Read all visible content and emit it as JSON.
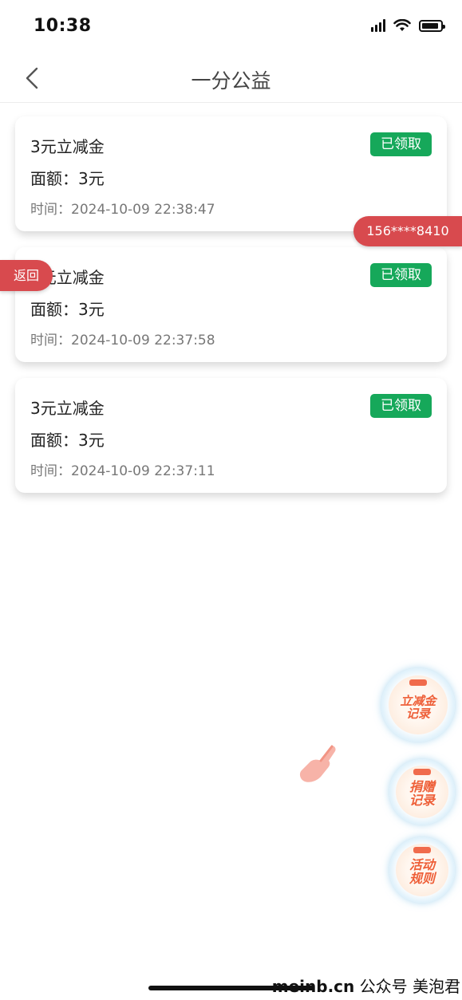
{
  "status_bar": {
    "time": "10:38"
  },
  "nav": {
    "title": "一分公益"
  },
  "records": [
    {
      "title": "3元立减金",
      "amount": "面额：3元",
      "time": "时间：2024-10-09 22:38:47",
      "status": "已领取"
    },
    {
      "title": "3元立减金",
      "amount": "面额：3元",
      "time": "时间：2024-10-09 22:37:58",
      "status": "已领取"
    },
    {
      "title": "3元立减金",
      "amount": "面额：3元",
      "time": "时间：2024-10-09 22:37:11",
      "status": "已领取"
    }
  ],
  "overlay": {
    "phone_tag": "156****8410",
    "return_tab": "返回"
  },
  "floating_buttons": [
    {
      "line1": "立减金",
      "line2": "记录"
    },
    {
      "line1": "捐赠",
      "line2": "记录"
    },
    {
      "line1": "活动",
      "line2": "规则"
    }
  ],
  "watermark": {
    "site": "meinb.cn",
    "text": "公众号 美泡君"
  },
  "colors": {
    "badge": "#16a85a",
    "tag": "#d84a4e",
    "float_text": "#ee5f38"
  },
  "icons": {
    "back": "chevron-left-icon",
    "signal": "signal-icon",
    "wifi": "wifi-icon",
    "battery": "battery-icon",
    "hand": "pointing-hand-icon"
  },
  "battery_level": 0.9
}
